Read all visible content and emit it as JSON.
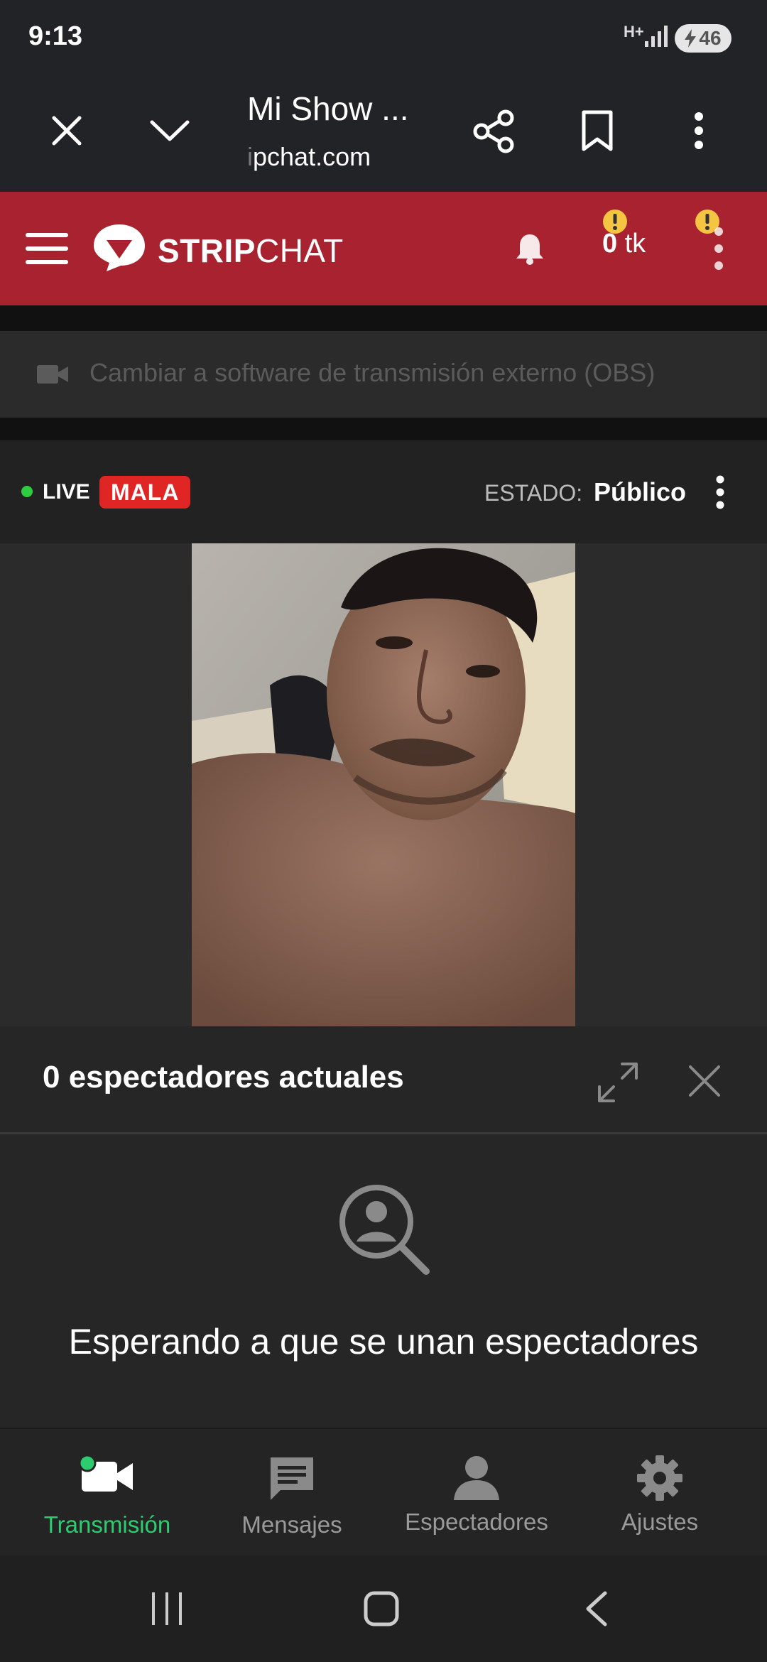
{
  "status_bar": {
    "time": "9:13",
    "network": "H+",
    "battery": "46"
  },
  "browser": {
    "title": "Mi Show ...",
    "url_prefix": "i",
    "url": "pchat.com"
  },
  "site": {
    "logo_bold": "STRIP",
    "logo_regular": "CHAT",
    "tokens_value": "0",
    "tokens_unit": "tk"
  },
  "obs": {
    "label": "Cambiar a software de transmisión externo (OBS)"
  },
  "live": {
    "live_label": "LIVE",
    "quality": "MALA",
    "estado_label": "ESTADO:",
    "estado_value": "Público"
  },
  "viewers": {
    "title": "0 espectadores actuales",
    "waiting": "Esperando a que se unan espectadores"
  },
  "nav": {
    "items": [
      {
        "label": "Transmisión",
        "icon": "camera-icon",
        "active": true
      },
      {
        "label": "Mensajes",
        "icon": "message-icon",
        "active": false
      },
      {
        "label": "Espectadores",
        "icon": "person-icon",
        "active": false
      },
      {
        "label": "Ajustes",
        "icon": "gear-icon",
        "active": false
      }
    ]
  },
  "colors": {
    "header_red": "#a8232f",
    "badge_red": "#e02525",
    "live_green": "#2ecc40",
    "active_nav": "#2ecc71",
    "warning_yellow": "#f5c542"
  }
}
